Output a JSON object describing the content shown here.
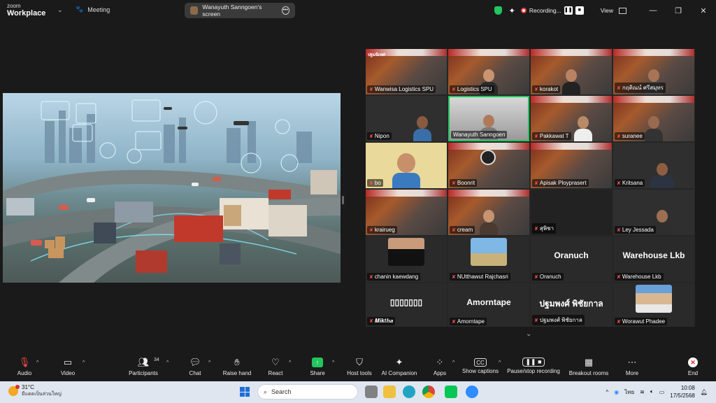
{
  "titlebar": {
    "logo_line1": "zoom",
    "logo_line2": "Workplace",
    "meeting_label": "Meeting",
    "screen_label": "Wanayuth Sanngoen's screen",
    "recording_label": "Recording...",
    "view_label": "View"
  },
  "gallery": {
    "tiles": [
      {
        "name": "Wanwisa Logistics SPU",
        "muted": true
      },
      {
        "name": "Logistics SPU",
        "muted": true
      },
      {
        "name": "korakot",
        "muted": true
      },
      {
        "name": "กฤติณน์ ศรีสมุทร",
        "muted": true
      },
      {
        "name": "Nipon",
        "muted": true
      },
      {
        "name": "Wanayuth Sanngoen",
        "muted": false,
        "active": true
      },
      {
        "name": "Pakkawat T",
        "muted": true
      },
      {
        "name": "suranee",
        "muted": true
      },
      {
        "name": "bo",
        "muted": true
      },
      {
        "name": "Boonrit",
        "muted": true
      },
      {
        "name": "Apisak Ploypraser​t",
        "muted": true
      },
      {
        "name": "Kritsana",
        "muted": true
      },
      {
        "name": "krairueg",
        "muted": true
      },
      {
        "name": "cream",
        "muted": true
      },
      {
        "name": "สุพิชา",
        "muted": true
      },
      {
        "name": "Ley Jessada",
        "muted": true
      },
      {
        "name": "chanin kaewdang",
        "muted": true
      },
      {
        "name": "NUtthawut Rajchasri",
        "muted": true
      },
      {
        "name": "Oranuch",
        "muted": true,
        "big": "Oranuch"
      },
      {
        "name": "Warehouse Lkb",
        "muted": true,
        "big": "Warehouse Lkb"
      },
      {
        "name": "𝑴𝒊𝒌𝒕𝒉𝒂",
        "muted": true,
        "big": "▯▯▯▯▯▯▯"
      },
      {
        "name": "Amorntape",
        "muted": true,
        "big": "Amorntape"
      },
      {
        "name": "ปฐมพงศ์ พิชัยกาล",
        "muted": true,
        "big": "ปฐมพงศ์ พิชัยกาล"
      },
      {
        "name": "Worawut Phadee",
        "muted": true
      }
    ]
  },
  "controls": {
    "audio": "Audio",
    "video": "Video",
    "participants": "Participants",
    "participants_count": "34",
    "chat": "Chat",
    "raise_hand": "Raise hand",
    "react": "React",
    "share": "Share",
    "host_tools": "Host tools",
    "ai_companion": "AI Companion",
    "apps": "Apps",
    "show_captions": "Show captions",
    "pause_recording": "Pause/stop recording",
    "breakout_rooms": "Breakout rooms",
    "more": "More",
    "end": "End"
  },
  "taskbar": {
    "temp": "31°C",
    "weather_desc": "มีแดดเป็นส่วนใหญ่",
    "search_placeholder": "Search",
    "lang": "ไทย",
    "time": "10:08",
    "date": "17/5/2568"
  }
}
